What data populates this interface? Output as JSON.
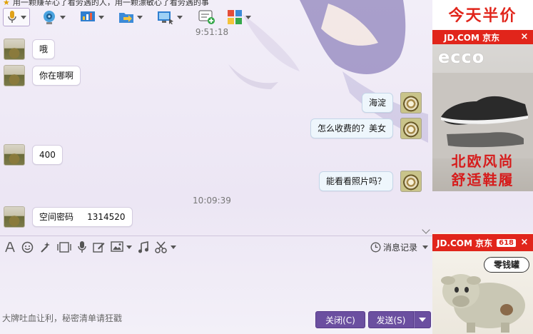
{
  "title_strip": {
    "text": "用一颗赚辛心了看劳遇的人，用一颗漂敏心了看劳遇的事"
  },
  "toolbar": {
    "items": [
      {
        "name": "microphone",
        "icon": "microphone-icon"
      },
      {
        "name": "video",
        "icon": "webcam-icon"
      },
      {
        "name": "share-screen",
        "icon": "presentation-icon"
      },
      {
        "name": "send-file",
        "icon": "folder-transfer-icon"
      },
      {
        "name": "remote-assist",
        "icon": "remote-desktop-icon"
      },
      {
        "name": "new-chat",
        "icon": "chat-add-icon"
      },
      {
        "name": "apps",
        "icon": "apps-grid-icon"
      }
    ]
  },
  "chat": {
    "messages": [
      {
        "type": "timestamp",
        "text": "9:51:18"
      },
      {
        "type": "friend",
        "text": "哦"
      },
      {
        "type": "friend",
        "text": "你在哪啊"
      },
      {
        "type": "me",
        "text": "海淀"
      },
      {
        "type": "me",
        "text": "怎么收费的？美女"
      },
      {
        "type": "friend",
        "text": "400"
      },
      {
        "type": "me",
        "text": "能看看照片吗？"
      },
      {
        "type": "timestamp",
        "text": "10:09:39"
      },
      {
        "type": "friend",
        "text": "空间密码     1314520"
      }
    ]
  },
  "input_toolbar": {
    "icons": [
      "font-icon",
      "emoji-icon",
      "magic-wand-icon",
      "screenshot-frame-icon",
      "voice-icon",
      "edit-icon",
      "image-icon",
      "music-icon",
      "scissors-icon"
    ],
    "history_label": "消息记录"
  },
  "bottom": {
    "placeholder_text": "大牌吐血让利，秘密清单请狂戳",
    "close_label": "关闭(C)",
    "send_label": "发送(S)"
  },
  "ads": {
    "ad1": {
      "headline": "今天半价",
      "jd": "JD.COM 京东",
      "brand": "ecco",
      "line1": "北欧风尚",
      "line2": "舒适鞋履",
      "close": "×"
    },
    "ad2": {
      "jd": "JD.COM 京东",
      "tag": "618",
      "label": "零钱罐",
      "close": "×"
    }
  },
  "colors": {
    "accent": "#6b4fa0",
    "jd_red": "#e1251b"
  }
}
